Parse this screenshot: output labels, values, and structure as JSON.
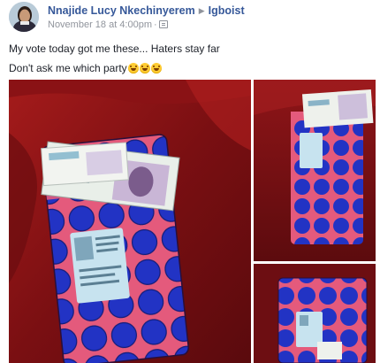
{
  "post": {
    "author": "Nnajide Lucy Nkechinyerem",
    "group": "Igboist",
    "timestamp": "November 18 at 4:00pm",
    "text_line1": "My vote today got me these... Haters stay far",
    "text_line2": "Don't ask me which party",
    "emoji_count": 3
  },
  "icons": {
    "share_arrow": "right-arrow-icon",
    "privacy": "group-privacy-icon",
    "emoji": "laughing-tears-emoji-icon"
  },
  "photos": [
    {
      "id": "main",
      "description_colors": {
        "sofa": "#8e1414",
        "purse_base": "#e0567a",
        "circles": "#1f2fc0"
      }
    },
    {
      "id": "top-right"
    },
    {
      "id": "bottom-right"
    }
  ],
  "colors": {
    "link": "#365899",
    "meta": "#90949c",
    "text": "#1d2129"
  }
}
